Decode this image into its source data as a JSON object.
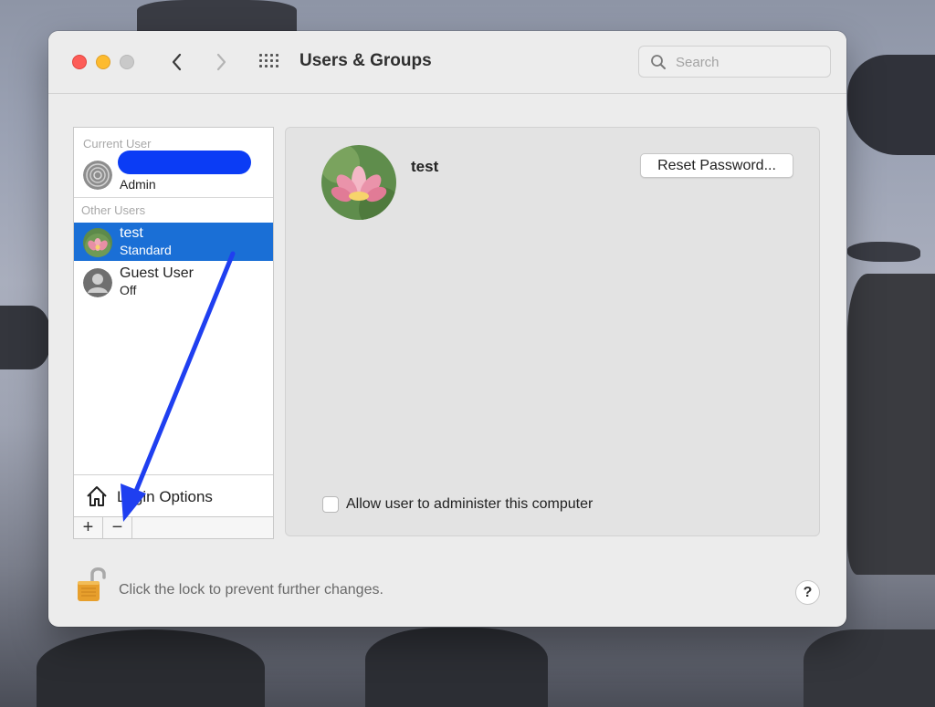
{
  "window": {
    "title": "Users & Groups"
  },
  "search": {
    "placeholder": "Search"
  },
  "sidebar": {
    "current_user_label": "Current User",
    "current_user": {
      "role": "Admin"
    },
    "other_users_label": "Other Users",
    "users": [
      {
        "name": "test",
        "role": "Standard",
        "selected": true
      },
      {
        "name": "Guest User",
        "role": "Off",
        "selected": false
      }
    ],
    "login_options_label": "Login Options",
    "add_label": "+",
    "remove_label": "−"
  },
  "detail": {
    "user_name": "test",
    "reset_password_label": "Reset Password...",
    "admin_checkbox_label": "Allow user to administer this computer",
    "admin_checked": false
  },
  "footer": {
    "lock_text": "Click the lock to prevent further changes.",
    "help_label": "?"
  },
  "colors": {
    "selection": "#1a6fd6",
    "annotation_arrow": "#1f3ff0",
    "redaction": "#0b3cf5"
  }
}
